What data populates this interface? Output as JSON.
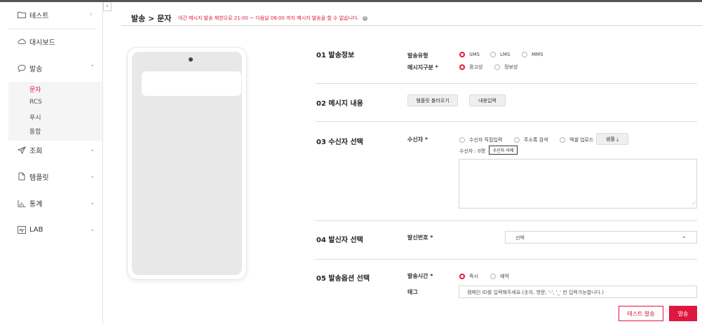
{
  "sidebar": {
    "top": {
      "label": "테스트",
      "icon": "folder-icon"
    },
    "items": [
      {
        "label": "대시보드",
        "icon": "cloud-icon"
      },
      {
        "label": "발송",
        "icon": "chat-bubble-icon",
        "chevron": "⌃"
      },
      {
        "label": "조회",
        "icon": "send-icon",
        "chevron": "⌄"
      },
      {
        "label": "템플릿",
        "icon": "document-icon",
        "chevron": "⌄"
      },
      {
        "label": "통계",
        "icon": "bar-chart-icon",
        "chevron": "⌄"
      },
      {
        "label": "LAB",
        "icon": "lab-icon",
        "chevron": "⌄"
      }
    ],
    "sub_items": [
      "문자",
      "RCS",
      "푸시",
      "통합"
    ],
    "collapse_glyph": "‹"
  },
  "header": {
    "breadcrumb": "발송 > 문자",
    "notice": "야간 메시지 발송 제한으로 21:00 ~ 다음날 08:00 까지 메시지 발송을 할 수 없습니다."
  },
  "sections": {
    "s1": {
      "title": "01 발송정보",
      "type_label": "발송유형",
      "type_options": [
        "SMS",
        "LMS",
        "MMS"
      ],
      "category_label": "메시지구분 *",
      "category_options": [
        "광고성",
        "정보성"
      ]
    },
    "s2": {
      "title": "02 메시지 내용",
      "template_button": "템플릿 불러오기",
      "content_button": "내용입력"
    },
    "s3": {
      "title": "03 수신자 선택",
      "label": "수신자 *",
      "options": [
        "수신자 직접입력",
        "주소록 검색",
        "엑셀 업로드"
      ],
      "sample_button": "샘플 ⤓",
      "count_text": "수신자 : 0명",
      "delete_button": "수신자 삭제"
    },
    "s4": {
      "title": "04 발신자 선택",
      "label": "발신번호 *",
      "select_value": "선택"
    },
    "s5": {
      "title": "05 발송옵션 선택",
      "time_label": "발송시간 *",
      "time_options": [
        "즉시",
        "예약"
      ],
      "tag_label": "태그",
      "tag_placeholder": "캠페인 ID를 입력해주세요.(숫자, 영문, '-', '_' 만 입력가능합니다.)"
    }
  },
  "actions": {
    "test_send": "테스트 발송",
    "send": "발송"
  },
  "colors": {
    "accent": "#e0173f"
  }
}
